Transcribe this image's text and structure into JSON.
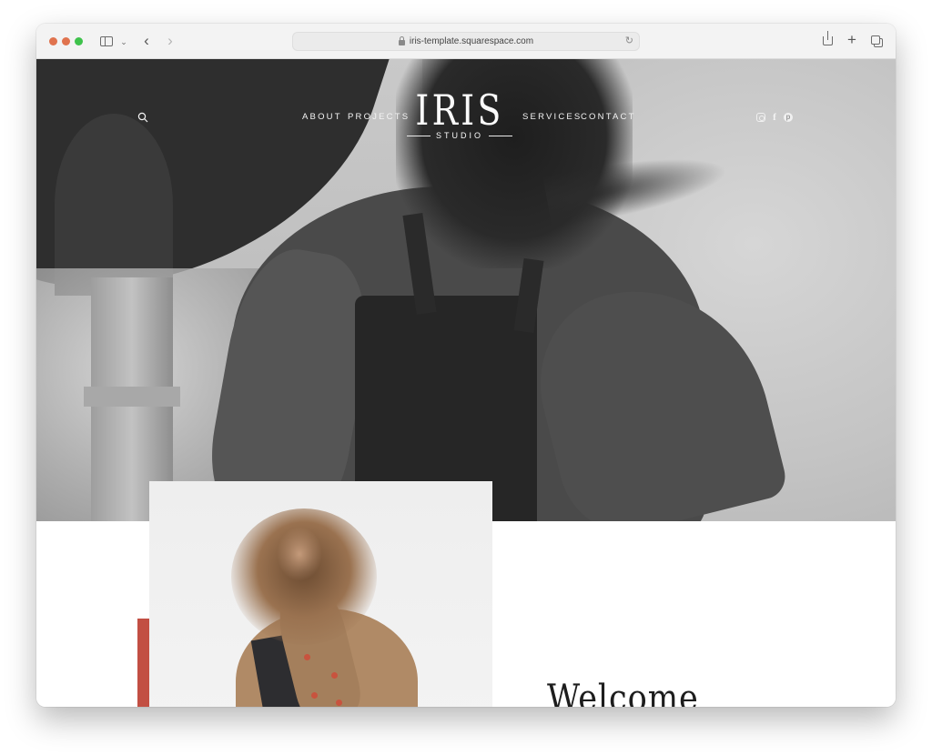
{
  "browser": {
    "url": "iris-template.squarespace.com",
    "icons": {
      "sidebar": "sidebar-toggle-icon",
      "tab_menu": "chevron-down-icon",
      "back": "chevron-left-icon",
      "forward": "chevron-right-icon",
      "secure": "lock-icon",
      "reload": "reload-icon",
      "share": "share-icon",
      "new_tab": "plus-icon",
      "tab_overview": "tabs-icon"
    },
    "glyphs": {
      "tab_menu": "⌄",
      "back": "‹",
      "forward": "›",
      "reload": "↻",
      "new_tab": "+"
    }
  },
  "site": {
    "logo": {
      "title": "IRIS",
      "subtitle": "STUDIO"
    },
    "nav": {
      "left": [
        "ABOUT",
        "PROJECTS"
      ],
      "right": [
        "SERVICES",
        "CONTACT"
      ]
    },
    "social": [
      {
        "name": "instagram",
        "glyph": ""
      },
      {
        "name": "facebook",
        "glyph": "f"
      },
      {
        "name": "pinterest",
        "glyph": "p"
      }
    ],
    "welcome_heading": "Welcome",
    "accent_color": "#c24f43"
  }
}
